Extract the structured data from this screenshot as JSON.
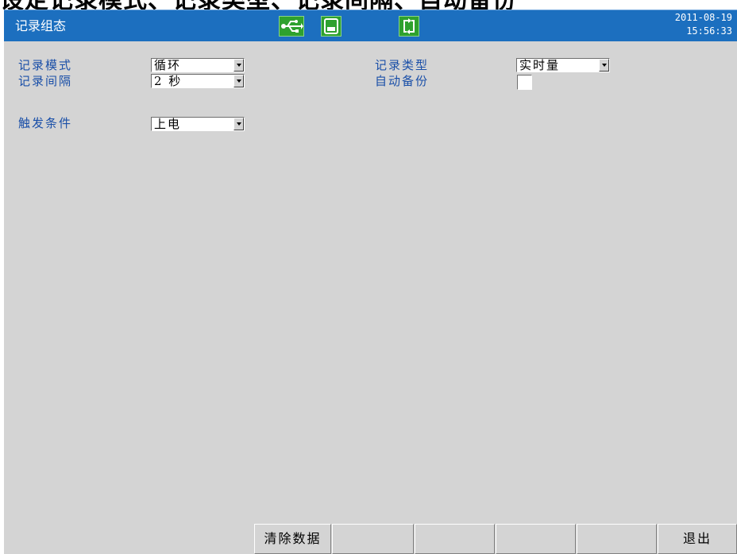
{
  "caption": "设定记录模式、记录类型、记录间隔、自动备份",
  "header": {
    "title": "记录组态",
    "date": "2011-08-19",
    "time": "15:56:33",
    "icons": [
      "usb-icon",
      "sd-card-icon",
      "sync-icon"
    ],
    "accent": "#1c6fbf",
    "icon_color": "#2ea12e"
  },
  "form": {
    "record_mode": {
      "label": "记录模式",
      "value": "循环"
    },
    "record_interval": {
      "label": "记录间隔",
      "value": "2 秒"
    },
    "record_type": {
      "label": "记录类型",
      "value": "实时量"
    },
    "auto_backup": {
      "label": "自动备份",
      "checked": false
    },
    "trigger": {
      "label": "触发条件",
      "value": "上电"
    }
  },
  "softkeys": [
    "清除数据",
    "",
    "",
    "",
    "",
    "退出"
  ]
}
